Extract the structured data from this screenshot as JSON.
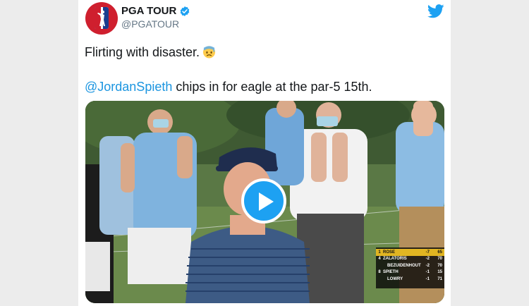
{
  "tweet": {
    "display_name": "PGA TOUR",
    "handle": "@PGATOUR",
    "text_line1": "Flirting with disaster.",
    "emoji": "anxious-face-with-sweat",
    "mention": "@JordanSpieth",
    "text_line2_rest": " chips in for eagle at the par-5 15th.",
    "icons": {
      "verified": "verified-badge-icon",
      "twitter": "twitter-bird-icon",
      "play": "play-icon"
    },
    "colors": {
      "accent": "#1da1f2",
      "mention": "#1b95e0",
      "brand_red": "#cf1f2e",
      "brand_blue": "#1b3d8f"
    }
  },
  "leaderboard": {
    "rows": [
      {
        "pos": "1",
        "name": "ROSE",
        "score": "-7",
        "total": "65",
        "leader": true
      },
      {
        "pos": "4",
        "name": "ZALATORIS",
        "score": "-2",
        "total": "70",
        "leader": false
      },
      {
        "pos": "",
        "name": "BEZUIDENHOUT",
        "score": "-2",
        "total": "70",
        "leader": false
      },
      {
        "pos": "8",
        "name": "SPIETH",
        "score": "-1",
        "total": "15",
        "leader": false
      },
      {
        "pos": "",
        "name": "LOWRY",
        "score": "-1",
        "total": "71",
        "leader": false
      }
    ]
  }
}
